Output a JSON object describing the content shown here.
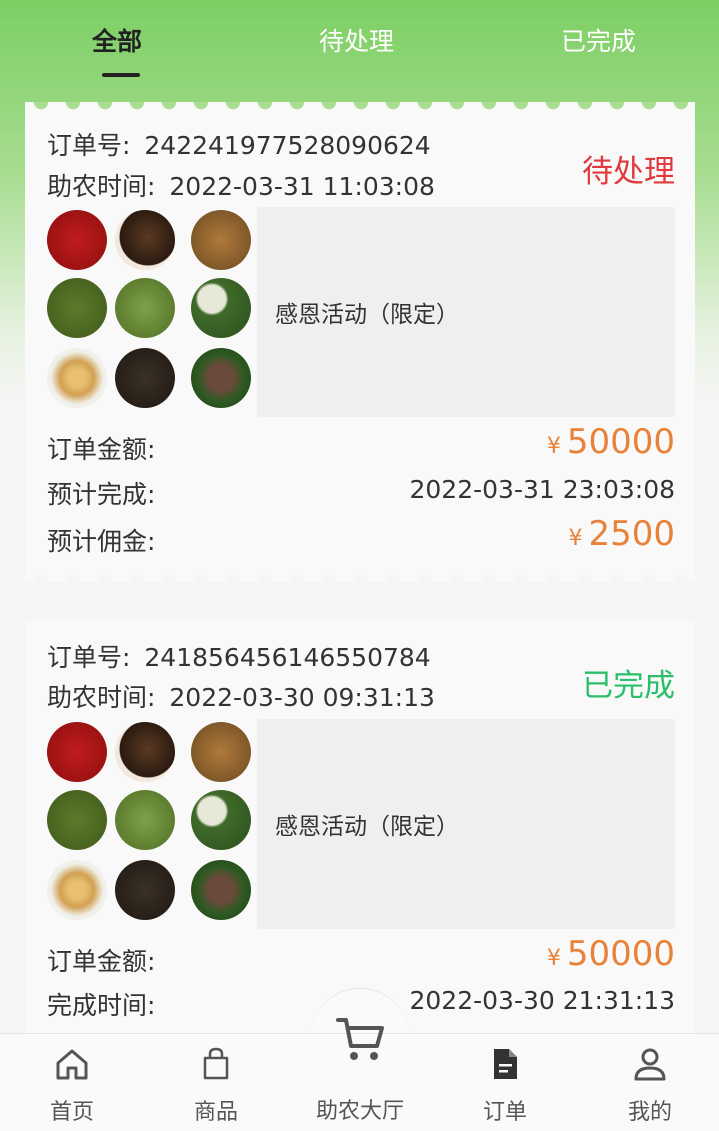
{
  "tabs": [
    {
      "label": "全部",
      "active": true
    },
    {
      "label": "待处理",
      "active": false
    },
    {
      "label": "已完成",
      "active": false
    }
  ],
  "orders": [
    {
      "order_no_label": "订单号:",
      "order_no": "242241977528090624",
      "time_label": "助农时间:",
      "time": "2022-03-31 11:03:08",
      "status": "待处理",
      "product_name": "感恩活动（限定）",
      "amount_label": "订单金额:",
      "amount_currency": "¥",
      "amount": "50000",
      "expected_label": "预计完成:",
      "expected": "2022-03-31 23:03:08",
      "commission_label": "预计佣金:",
      "commission_currency": "¥",
      "commission": "2500"
    },
    {
      "order_no_label": "订单号:",
      "order_no": "241856456146550784",
      "time_label": "助农时间:",
      "time": "2022-03-30 09:31:13",
      "status": "已完成",
      "product_name": "感恩活动（限定）",
      "amount_label": "订单金额:",
      "amount_currency": "¥",
      "amount": "50000",
      "finished_label": "完成时间:",
      "finished": "2022-03-30 21:31:13"
    }
  ],
  "product_thumbnails": [
    "saffron-image",
    "mushroom-image",
    "cordyceps-image",
    "green-tea-image",
    "tea-leaves-image",
    "tea-bowl-image",
    "ginseng-image",
    "black-tea-image",
    "reishi-image"
  ],
  "nav": [
    {
      "label": "首页",
      "icon": "home-icon",
      "active": false
    },
    {
      "label": "商品",
      "icon": "bag-icon",
      "active": false
    },
    {
      "label": "助农大厅",
      "icon": "cart-icon",
      "active": false
    },
    {
      "label": "订单",
      "icon": "document-icon",
      "active": true
    },
    {
      "label": "我的",
      "icon": "user-icon",
      "active": false
    }
  ],
  "colors": {
    "pending": "#e0393e",
    "done": "#2bbf6a",
    "price": "#e8823a",
    "header_green": "#7ccf63"
  }
}
